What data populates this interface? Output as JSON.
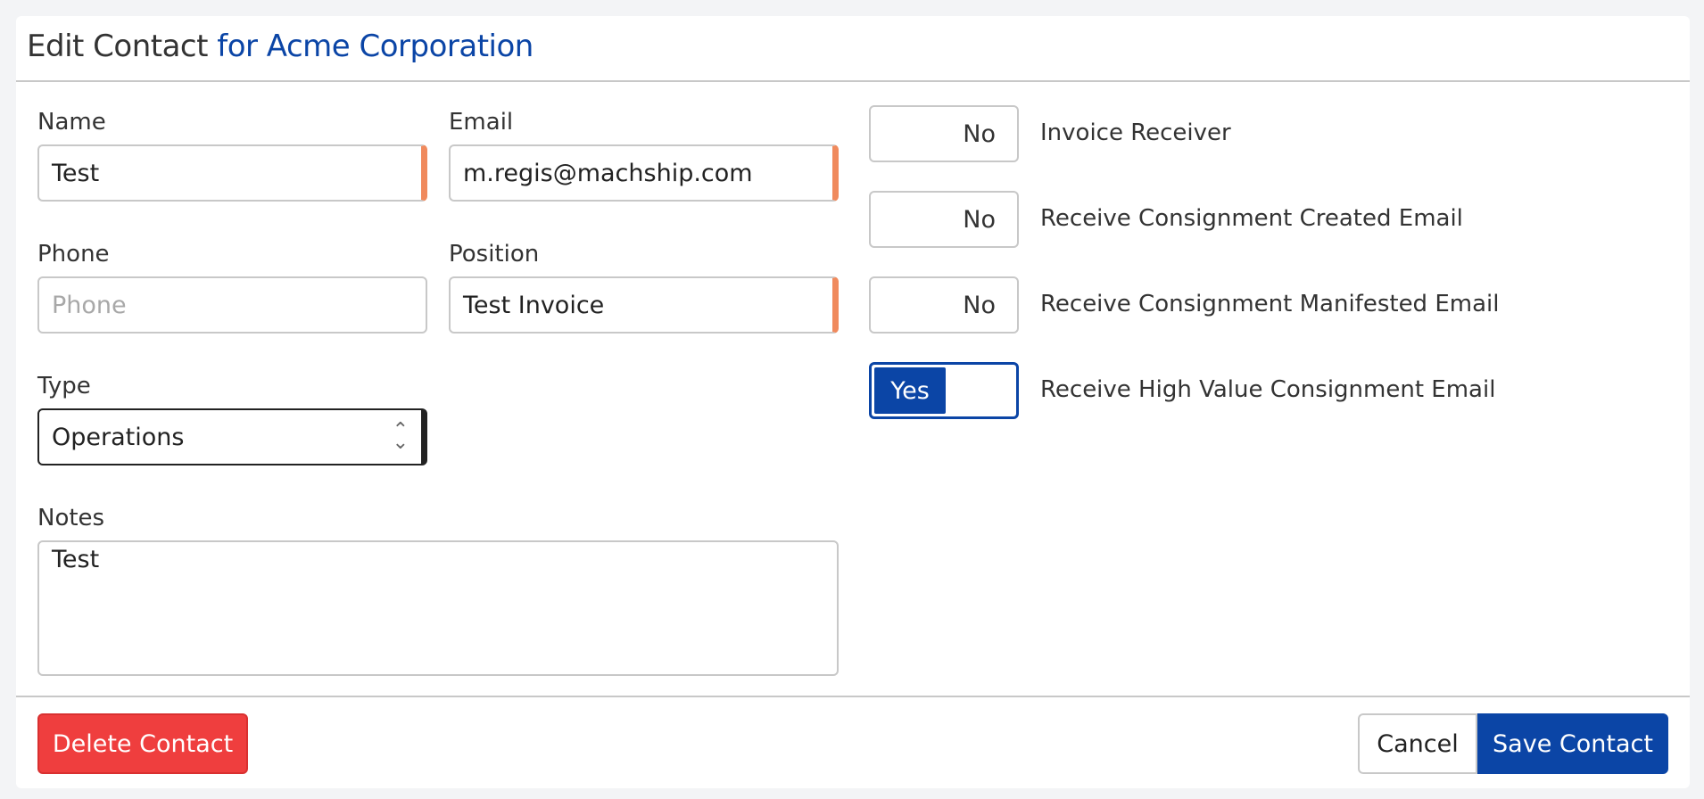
{
  "header": {
    "title": "Edit Contact",
    "company": "for Acme Corporation"
  },
  "form": {
    "name": {
      "label": "Name",
      "value": "Test"
    },
    "email": {
      "label": "Email",
      "value": "m.regis@machship.com"
    },
    "phone": {
      "label": "Phone",
      "value": "",
      "placeholder": "Phone"
    },
    "position": {
      "label": "Position",
      "value": "Test Invoice"
    },
    "type": {
      "label": "Type",
      "value": "Operations"
    },
    "notes": {
      "label": "Notes",
      "value": "Test"
    }
  },
  "toggles": [
    {
      "label": "Invoice Receiver",
      "state": "No"
    },
    {
      "label": "Receive Consignment Created Email",
      "state": "No"
    },
    {
      "label": "Receive Consignment Manifested Email",
      "state": "No"
    },
    {
      "label": "Receive High Value Consignment Email",
      "state": "Yes"
    }
  ],
  "footer": {
    "delete_label": "Delete Contact",
    "cancel_label": "Cancel",
    "save_label": "Save Contact"
  },
  "colors": {
    "brand": "#0b45a6",
    "danger": "#ef3e3e",
    "required": "#f08a5d"
  }
}
